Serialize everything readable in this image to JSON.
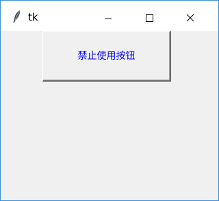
{
  "window": {
    "title": "tk"
  },
  "icons": {
    "app": "feather-icon",
    "minimize": "minimize-icon",
    "maximize": "maximize-icon",
    "close": "close-icon"
  },
  "main": {
    "button_label": "禁止使用按钮"
  },
  "colors": {
    "window_border": "#3c8ed6",
    "titlebar_bg": "#ffffff",
    "client_bg": "#f0f0f0",
    "button_text": "#0000ff"
  }
}
